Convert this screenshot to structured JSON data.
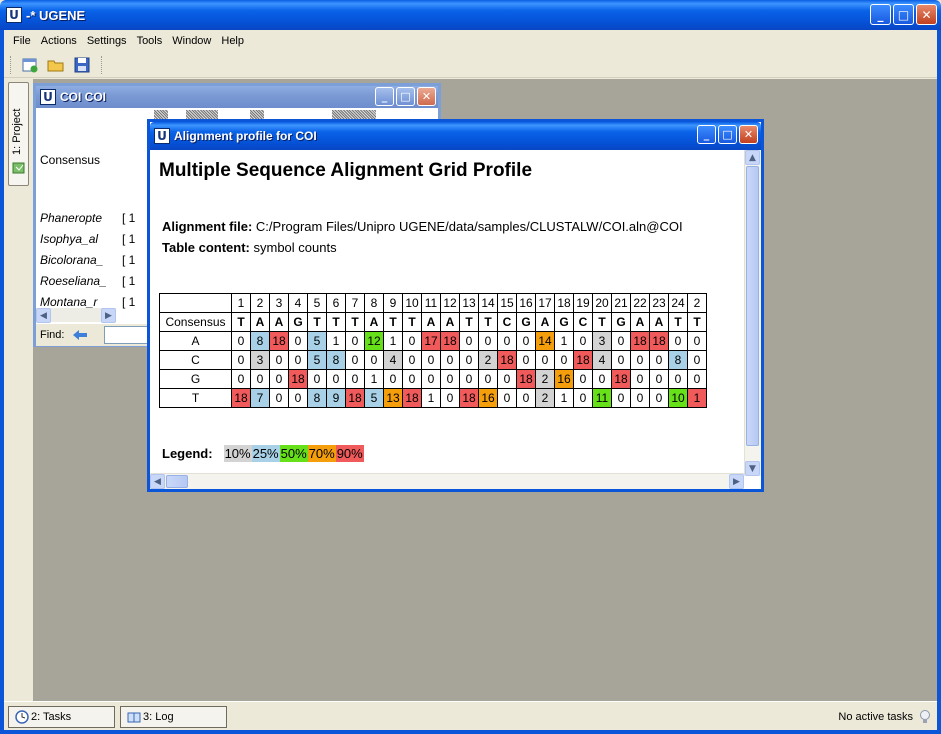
{
  "app": {
    "title": "-* UGENE",
    "logo": "U"
  },
  "menu": [
    {
      "label": "File"
    },
    {
      "label": "Actions"
    },
    {
      "label": "Settings"
    },
    {
      "label": "Tools"
    },
    {
      "label": "Window"
    },
    {
      "label": "Help"
    }
  ],
  "toolbar": {
    "icons": [
      "new-document-icon",
      "open-folder-icon",
      "save-icon"
    ]
  },
  "project_tab": {
    "label": "1: Project"
  },
  "coi_window": {
    "title": "COI COI",
    "consensus_label": "Consensus",
    "sequences": [
      "Phaneropte",
      "Isophya_al",
      "Bicolorana_",
      "Roeseliana_",
      "Montana_r"
    ],
    "brackets": [
      "[   1",
      "[   1",
      "[   1",
      "[   1",
      "[   1"
    ],
    "find_label": "Find:"
  },
  "profile_window": {
    "title": "Alignment profile for COI",
    "heading": "Multiple Sequence Alignment Grid Profile",
    "alignment_file_label": "Alignment file:",
    "alignment_file": "C:/Program Files/Unipro UGENE/data/samples/CLUSTALW/COI.aln@COI",
    "table_content_label": "Table content:",
    "table_content": "symbol counts",
    "columns": [
      "1",
      "2",
      "3",
      "4",
      "5",
      "6",
      "7",
      "8",
      "9",
      "10",
      "11",
      "12",
      "13",
      "14",
      "15",
      "16",
      "17",
      "18",
      "19",
      "20",
      "21",
      "22",
      "23",
      "24",
      "2"
    ],
    "consensus_label": "Consensus",
    "consensus": [
      "T",
      "A",
      "A",
      "G",
      "T",
      "T",
      "T",
      "A",
      "T",
      "T",
      "A",
      "A",
      "T",
      "T",
      "C",
      "G",
      "A",
      "G",
      "C",
      "T",
      "G",
      "A",
      "A",
      "T",
      "T"
    ],
    "rows": [
      {
        "label": "A",
        "values": [
          "0",
          "8",
          "18",
          "0",
          "5",
          "1",
          "0",
          "12",
          "1",
          "0",
          "17",
          "18",
          "0",
          "0",
          "0",
          "0",
          "14",
          "1",
          "0",
          "3",
          "0",
          "18",
          "18",
          "0",
          "0"
        ],
        "shades": [
          "",
          "b",
          "r",
          "",
          "b",
          "",
          "",
          "g",
          "",
          "",
          "r",
          "r",
          "",
          "",
          "",
          "",
          "o",
          "",
          "",
          "l",
          "",
          "r",
          "r",
          "",
          ""
        ]
      },
      {
        "label": "C",
        "values": [
          "0",
          "3",
          "0",
          "0",
          "5",
          "8",
          "0",
          "0",
          "4",
          "0",
          "0",
          "0",
          "0",
          "2",
          "18",
          "0",
          "0",
          "0",
          "18",
          "4",
          "0",
          "0",
          "0",
          "8",
          "0"
        ],
        "shades": [
          "",
          "l",
          "",
          "",
          "b",
          "b",
          "",
          "",
          "l",
          "",
          "",
          "",
          "",
          "l",
          "r",
          "",
          "",
          "",
          "r",
          "l",
          "",
          "",
          "",
          "b",
          ""
        ]
      },
      {
        "label": "G",
        "values": [
          "0",
          "0",
          "0",
          "18",
          "0",
          "0",
          "0",
          "1",
          "0",
          "0",
          "0",
          "0",
          "0",
          "0",
          "0",
          "18",
          "2",
          "16",
          "0",
          "0",
          "18",
          "0",
          "0",
          "0",
          "0"
        ],
        "shades": [
          "",
          "",
          "",
          "r",
          "",
          "",
          "",
          "",
          "",
          "",
          "",
          "",
          "",
          "",
          "",
          "r",
          "l",
          "o",
          "",
          "",
          "r",
          "",
          "",
          "",
          ""
        ]
      },
      {
        "label": "T",
        "values": [
          "18",
          "7",
          "0",
          "0",
          "8",
          "9",
          "18",
          "5",
          "13",
          "18",
          "1",
          "0",
          "18",
          "16",
          "0",
          "0",
          "2",
          "1",
          "0",
          "11",
          "0",
          "0",
          "0",
          "10",
          "1"
        ],
        "shades": [
          "r",
          "b",
          "",
          "",
          "b",
          "b",
          "r",
          "b",
          "o",
          "r",
          "",
          "",
          "r",
          "o",
          "",
          "",
          "l",
          "",
          "",
          "g",
          "",
          "",
          "",
          "g",
          "r"
        ]
      }
    ],
    "legend_label": "Legend:",
    "legend": [
      {
        "label": "10%",
        "color": "#d3d3d3"
      },
      {
        "label": "25%",
        "color": "#a8d1e8"
      },
      {
        "label": "50%",
        "color": "#66e019"
      },
      {
        "label": "70%",
        "color": "#f59e0b"
      },
      {
        "label": "90%",
        "color": "#f05a5a"
      }
    ]
  },
  "statusbar": {
    "tasks_label": "2: Tasks",
    "log_label": "3: Log",
    "status": "No active tasks"
  }
}
